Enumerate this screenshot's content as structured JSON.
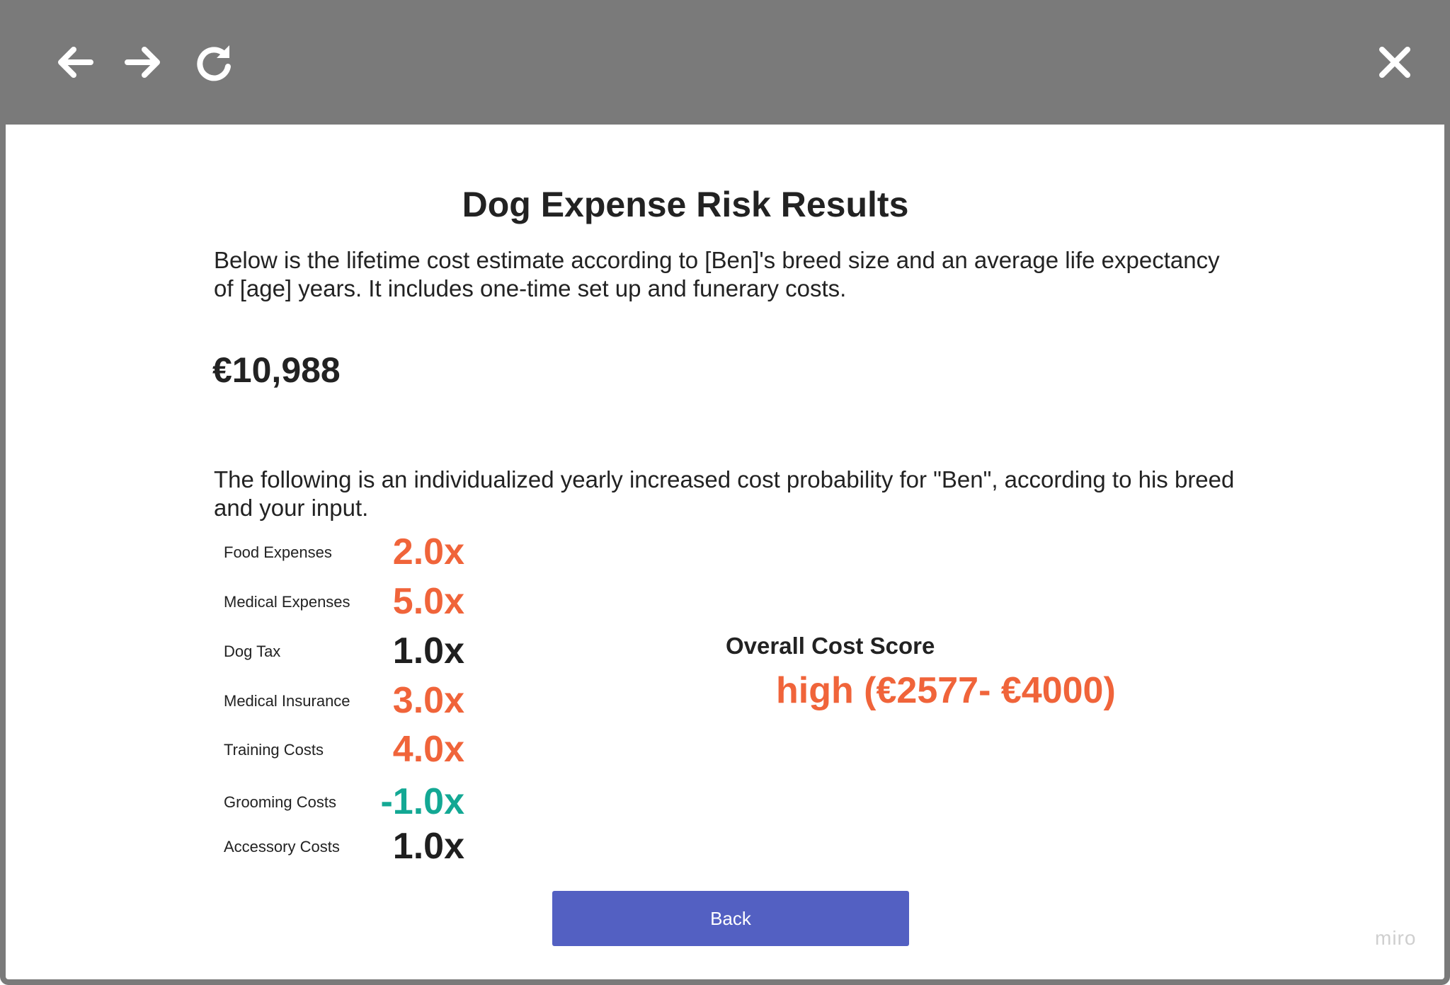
{
  "toolbar": {
    "back_icon": "arrow-left-icon",
    "forward_icon": "arrow-right-icon",
    "reload_icon": "reload-icon",
    "close_icon": "close-icon"
  },
  "page": {
    "title": "Dog Expense Risk Results",
    "intro": "Below is the lifetime cost estimate according to [Ben]'s breed size and an average life expectancy of [age] years. It includes one-time set up and funerary costs.",
    "total_cost": "€10,988",
    "probability_intro": "The following is an individualized yearly increased cost probability for \"Ben\", according to his breed and your input."
  },
  "factors": [
    {
      "label": "Food Expenses",
      "value": "2.0x",
      "color": "#f0643a"
    },
    {
      "label": "Medical Expenses",
      "value": "5.0x",
      "color": "#f0643a"
    },
    {
      "label": "Dog Tax",
      "value": "1.0x",
      "color": "#1f1f1f"
    },
    {
      "label": "Medical Insurance",
      "value": "3.0x",
      "color": "#f0643a"
    },
    {
      "label": "Training Costs",
      "value": "4.0x",
      "color": "#f0643a"
    },
    {
      "label": "Grooming Costs",
      "value": "-1.0x",
      "color": "#13a894"
    },
    {
      "label": "Accessory Costs",
      "value": "1.0x",
      "color": "#1f1f1f"
    }
  ],
  "score": {
    "title": "Overall Cost Score",
    "value": "high (€2577- €4000)",
    "color": "#f0643a"
  },
  "back_button": {
    "label": "Back"
  },
  "watermark": "miro",
  "colors": {
    "titlebar": "#7a7a7a",
    "button": "#5360c2",
    "high": "#f0643a",
    "low": "#13a894",
    "neutral": "#1f1f1f"
  }
}
